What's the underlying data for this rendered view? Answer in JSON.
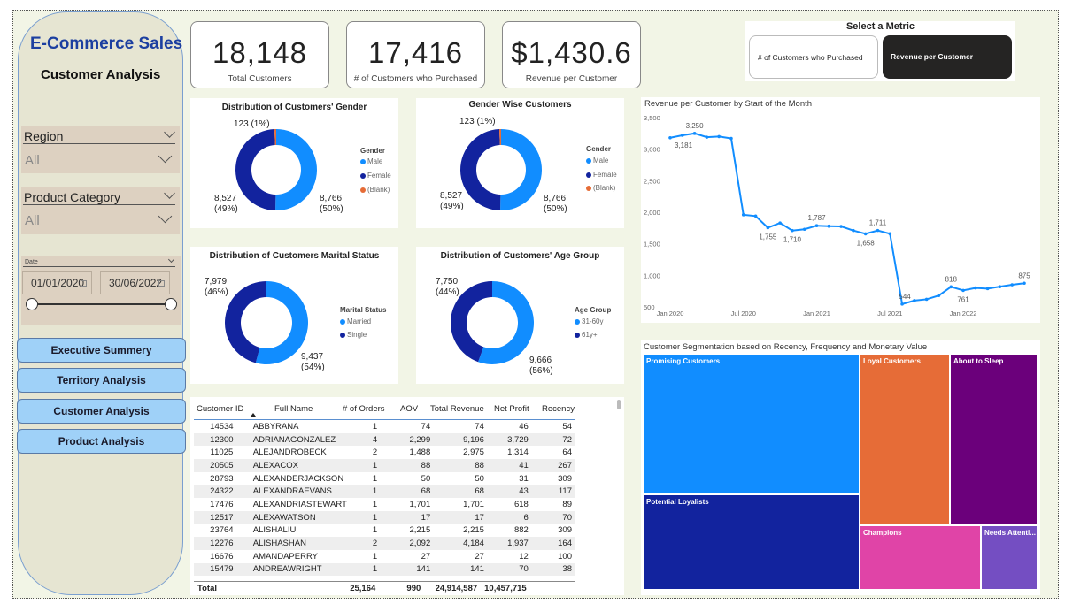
{
  "brand": {
    "title": "E-Commerce Sales",
    "subtitle": "Customer Analysis"
  },
  "filters": {
    "region": {
      "label": "Region",
      "value": "All"
    },
    "category": {
      "label": "Product Category",
      "value": "All"
    },
    "date": {
      "label": "Date",
      "start": "01/01/2020",
      "end": "30/06/2022"
    }
  },
  "nav": [
    "Executive Summery",
    "Territory Analysis",
    "Customer Analysis",
    "Product Analysis"
  ],
  "kpis": [
    {
      "value": "18,148",
      "label": "Total Customers"
    },
    {
      "value": "17,416",
      "label": "# of Customers who Purchased"
    },
    {
      "value": "$1,430.6",
      "label": "Revenue per Customer"
    }
  ],
  "metric_selector": {
    "title": "Select a Metric",
    "options": [
      "# of Customers who Purchased",
      "Revenue per Customer"
    ],
    "selected": "Revenue per Customer"
  },
  "donuts": [
    {
      "title": "Distribution of Customers' Gender",
      "legend_title": "Gender",
      "legend": [
        {
          "name": "Male",
          "color": "#118dff"
        },
        {
          "name": "Female",
          "color": "#12239e"
        },
        {
          "name": "(Blank)",
          "color": "#e66c37"
        }
      ],
      "values": [
        8766,
        8527,
        123
      ],
      "labels": [
        "8,766\n(50%)",
        "8,527\n(49%)",
        "123 (1%)"
      ]
    },
    {
      "title": "Gender Wise Customers",
      "legend_title": "Gender",
      "legend": [
        {
          "name": "Male",
          "color": "#118dff"
        },
        {
          "name": "Female",
          "color": "#12239e"
        },
        {
          "name": "(Blank)",
          "color": "#e66c37"
        }
      ],
      "values": [
        8766,
        8527,
        123
      ],
      "labels": [
        "8,766\n(50%)",
        "8,527\n(49%)",
        "123 (1%)"
      ]
    },
    {
      "title": "Distribution of Customers Marital Status",
      "legend_title": "Marital Status",
      "legend": [
        {
          "name": "Married",
          "color": "#118dff"
        },
        {
          "name": "Single",
          "color": "#12239e"
        }
      ],
      "values": [
        9437,
        7979
      ],
      "labels": [
        "9,437\n(54%)",
        "7,979\n(46%)"
      ]
    },
    {
      "title": "Distribution of Customers' Age Group",
      "legend_title": "Age Group",
      "legend": [
        {
          "name": "31-60y",
          "color": "#118dff"
        },
        {
          "name": "61y+",
          "color": "#12239e"
        }
      ],
      "values": [
        9666,
        7750
      ],
      "labels": [
        "9,666\n(56%)",
        "7,750\n(44%)"
      ]
    }
  ],
  "table": {
    "columns": [
      "Customer ID",
      "Full Name",
      "# of Orders",
      "AOV",
      "Total Revenue",
      "Net Profit",
      "Recency"
    ],
    "rows": [
      [
        "14534",
        "ABBYRANA",
        "1",
        "74",
        "74",
        "46",
        "54"
      ],
      [
        "12300",
        "ADRIANAGONZALEZ",
        "4",
        "2,299",
        "9,196",
        "3,729",
        "72"
      ],
      [
        "11025",
        "ALEJANDROBECK",
        "2",
        "1,488",
        "2,975",
        "1,314",
        "64"
      ],
      [
        "20505",
        "ALEXACOX",
        "1",
        "88",
        "88",
        "41",
        "267"
      ],
      [
        "28793",
        "ALEXANDERJACKSON",
        "1",
        "50",
        "50",
        "31",
        "309"
      ],
      [
        "24322",
        "ALEXANDRAEVANS",
        "1",
        "68",
        "68",
        "43",
        "117"
      ],
      [
        "17476",
        "ALEXANDRIASTEWART",
        "1",
        "1,701",
        "1,701",
        "618",
        "89"
      ],
      [
        "12517",
        "ALEXAWATSON",
        "1",
        "17",
        "17",
        "6",
        "70"
      ],
      [
        "23764",
        "ALISHALIU",
        "1",
        "2,215",
        "2,215",
        "882",
        "309"
      ],
      [
        "12276",
        "ALISHASHAN",
        "2",
        "2,092",
        "4,184",
        "1,937",
        "164"
      ],
      [
        "16676",
        "AMANDAPERRY",
        "1",
        "27",
        "27",
        "12",
        "100"
      ],
      [
        "15479",
        "ANDREAWRIGHT",
        "1",
        "141",
        "141",
        "70",
        "38"
      ]
    ],
    "total": [
      "Total",
      "",
      "25,164",
      "990",
      "24,914,587",
      "10,457,715",
      ""
    ]
  },
  "chart_data": {
    "type": "line",
    "title": "Revenue per Customer by Start of the Month",
    "x_ticks": [
      "Jan 2020",
      "Jul 2020",
      "Jan 2021",
      "Jul 2021",
      "Jan 2022"
    ],
    "y_ticks": [
      "500",
      "1,000",
      "1,500",
      "2,000",
      "2,500",
      "3,000",
      "3,500"
    ],
    "ylim": [
      500,
      3500
    ],
    "x": [
      "2020-01",
      "2020-02",
      "2020-03",
      "2020-04",
      "2020-05",
      "2020-06",
      "2020-07",
      "2020-08",
      "2020-09",
      "2020-10",
      "2020-11",
      "2020-12",
      "2021-01",
      "2021-02",
      "2021-03",
      "2021-04",
      "2021-05",
      "2021-06",
      "2021-07",
      "2021-08",
      "2021-09",
      "2021-10",
      "2021-11",
      "2021-12",
      "2022-01",
      "2022-02",
      "2022-03",
      "2022-04",
      "2022-05",
      "2022-06"
    ],
    "values": [
      3181,
      3220,
      3250,
      3190,
      3200,
      3170,
      1960,
      1940,
      1755,
      1830,
      1710,
      1730,
      1787,
      1780,
      1775,
      1710,
      1658,
      1711,
      1660,
      544,
      600,
      620,
      680,
      818,
      761,
      800,
      790,
      820,
      850,
      875
    ],
    "point_labels": {
      "0": "3,181",
      "2": "3,250",
      "8": "1,755",
      "10": "1,710",
      "12": "1,787",
      "16": "1,658",
      "17": "1,711",
      "19": "544",
      "23": "818",
      "24": "761",
      "29": "875"
    },
    "color": "#118dff"
  },
  "treemap": {
    "title": "Customer Segmentation based on Recency, Frequency and Monetary Value",
    "segments": [
      {
        "name": "Promising Customers",
        "color": "#118dff"
      },
      {
        "name": "Potential Loyalists",
        "color": "#12239e"
      },
      {
        "name": "Loyal Customers",
        "color": "#e66c37"
      },
      {
        "name": "About to Sleep",
        "color": "#6b007b"
      },
      {
        "name": "Champions",
        "color": "#e044a7"
      },
      {
        "name": "Needs Attenti...",
        "color": "#744ec2"
      }
    ]
  }
}
